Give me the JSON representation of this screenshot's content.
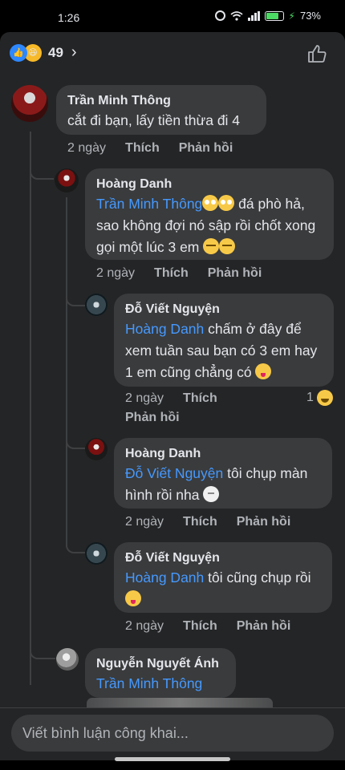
{
  "status_bar": {
    "time": "1:26",
    "battery": "73%"
  },
  "header": {
    "reaction_count": "49"
  },
  "comments": [
    {
      "author": "Trần Minh Thông",
      "text": "cắt đi bạn, lấy tiền thừa đi 4",
      "time": "2 ngày",
      "like": "Thích",
      "reply": "Phản hồi"
    },
    {
      "author": "Hoàng Danh",
      "mention": "Trần Minh Thông",
      "text": " đá phò hả, sao không đợi nó sập rồi chốt xong gọi một lúc 3 em ",
      "time": "2 ngày",
      "like": "Thích",
      "reply": "Phản hồi"
    },
    {
      "author": "Đỗ Viết Nguyện",
      "mention": "Hoàng Danh",
      "text": " chấm ở đây để xem tuần sau bạn có 3 em hay 1 em cũng chẳng có ",
      "time": "2 ngày",
      "like": "Thích",
      "reply": "Phản hồi",
      "reaction_count": "1"
    },
    {
      "author": "Hoàng Danh",
      "mention": "Đỗ Viết Nguyện",
      "text": " tôi chụp màn hình rồi nha ",
      "time": "2 ngày",
      "like": "Thích",
      "reply": "Phản hồi"
    },
    {
      "author": "Đỗ Viết Nguyện",
      "mention": "Hoàng Danh",
      "text": " tôi cũng chụp rồi ",
      "time": "2 ngày",
      "like": "Thích",
      "reply": "Phản hồi"
    },
    {
      "author": "Nguyễn Nguyết Ánh",
      "mention": "Trần Minh Thông"
    }
  ],
  "composer": {
    "placeholder": "Viết bình luận công khai..."
  }
}
